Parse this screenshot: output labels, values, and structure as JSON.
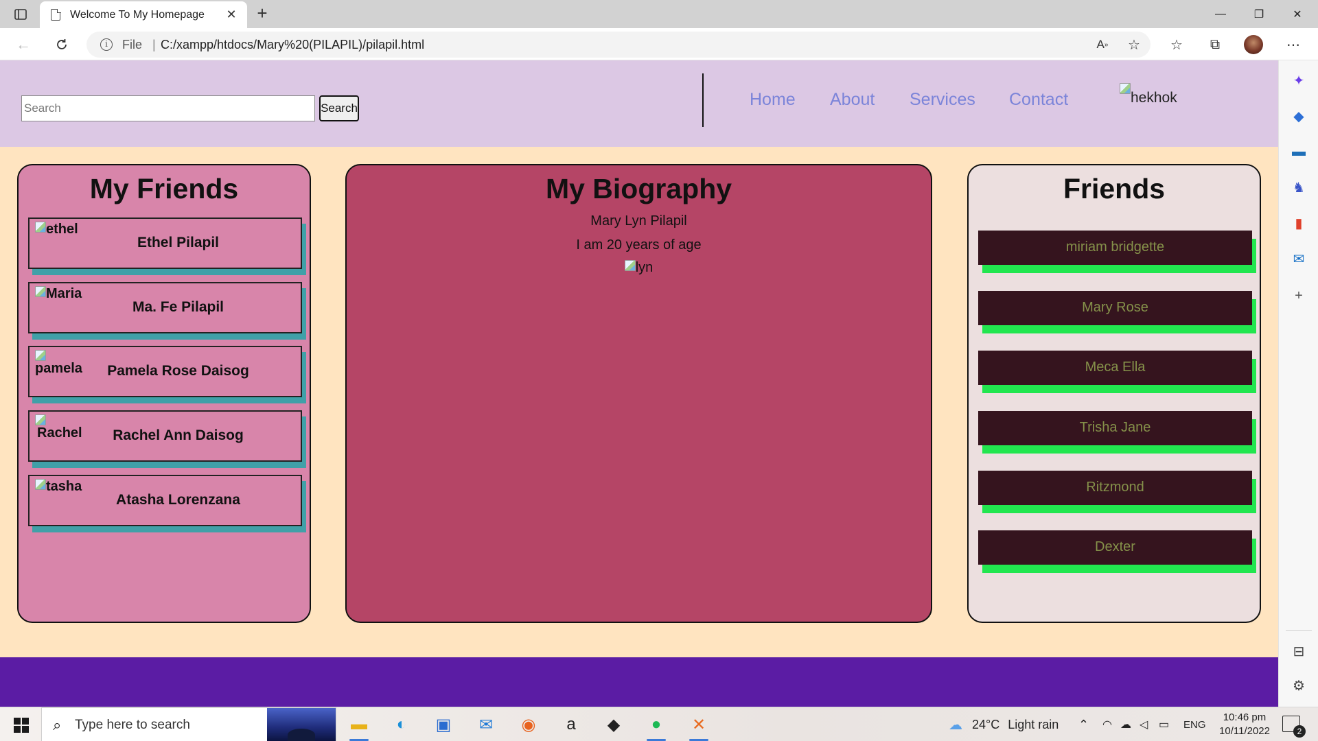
{
  "browser": {
    "tab_title": "Welcome To My Homepage",
    "tab_close": "✕",
    "new_tab": "+",
    "address_scheme": "File",
    "address_separator": "|",
    "url": "C:/xampp/htdocs/Mary%20(PILAPIL)/pilapil.html",
    "win_minimize": "—",
    "win_restore": "❐",
    "win_close": "✕"
  },
  "header": {
    "search_placeholder": "Search",
    "search_button": "Search",
    "nav": [
      "Home",
      "About",
      "Services",
      "Contact"
    ],
    "logo_alt": "hekhok"
  },
  "left_panel": {
    "title": "My Friends",
    "friends": [
      {
        "img_alt": "ethel",
        "name": "Ethel Pilapil"
      },
      {
        "img_alt": "Maria",
        "name": "Ma. Fe Pilapil"
      },
      {
        "img_alt": "pamela",
        "name": "Pamela Rose Daisog"
      },
      {
        "img_alt": "Rachel",
        "name": "Rachel Ann Daisog"
      },
      {
        "img_alt": "tasha",
        "name": "Atasha Lorenzana"
      }
    ]
  },
  "center_panel": {
    "title": "My Biography",
    "name": "Mary Lyn Pilapil",
    "age": "I am 20 years of age",
    "img_alt": "lyn"
  },
  "right_panel": {
    "title": "Friends",
    "friends": [
      "miriam bridgette",
      "Mary Rose",
      "Meca Ella",
      "Trisha Jane",
      "Ritzmond",
      "Dexter"
    ]
  },
  "taskbar": {
    "search_placeholder": "Type here to search",
    "weather_temp": "24°C",
    "weather_desc": "Light rain",
    "language": "ENG",
    "time": "10:46 pm",
    "date": "10/11/2022",
    "notification_count": "2"
  },
  "colors": {
    "header_bg": "#dcc8e4",
    "page_bg": "#ffe4c0",
    "left_panel": "#d885aa",
    "center_panel": "#b54566",
    "right_panel": "#ecdfdf",
    "friend_btn": "#35141e",
    "friend_btn_shadow": "#22e64f",
    "card_shadow": "#40a0a8",
    "footer": "#5b1ca4",
    "nav_link": "#7b84d9"
  }
}
